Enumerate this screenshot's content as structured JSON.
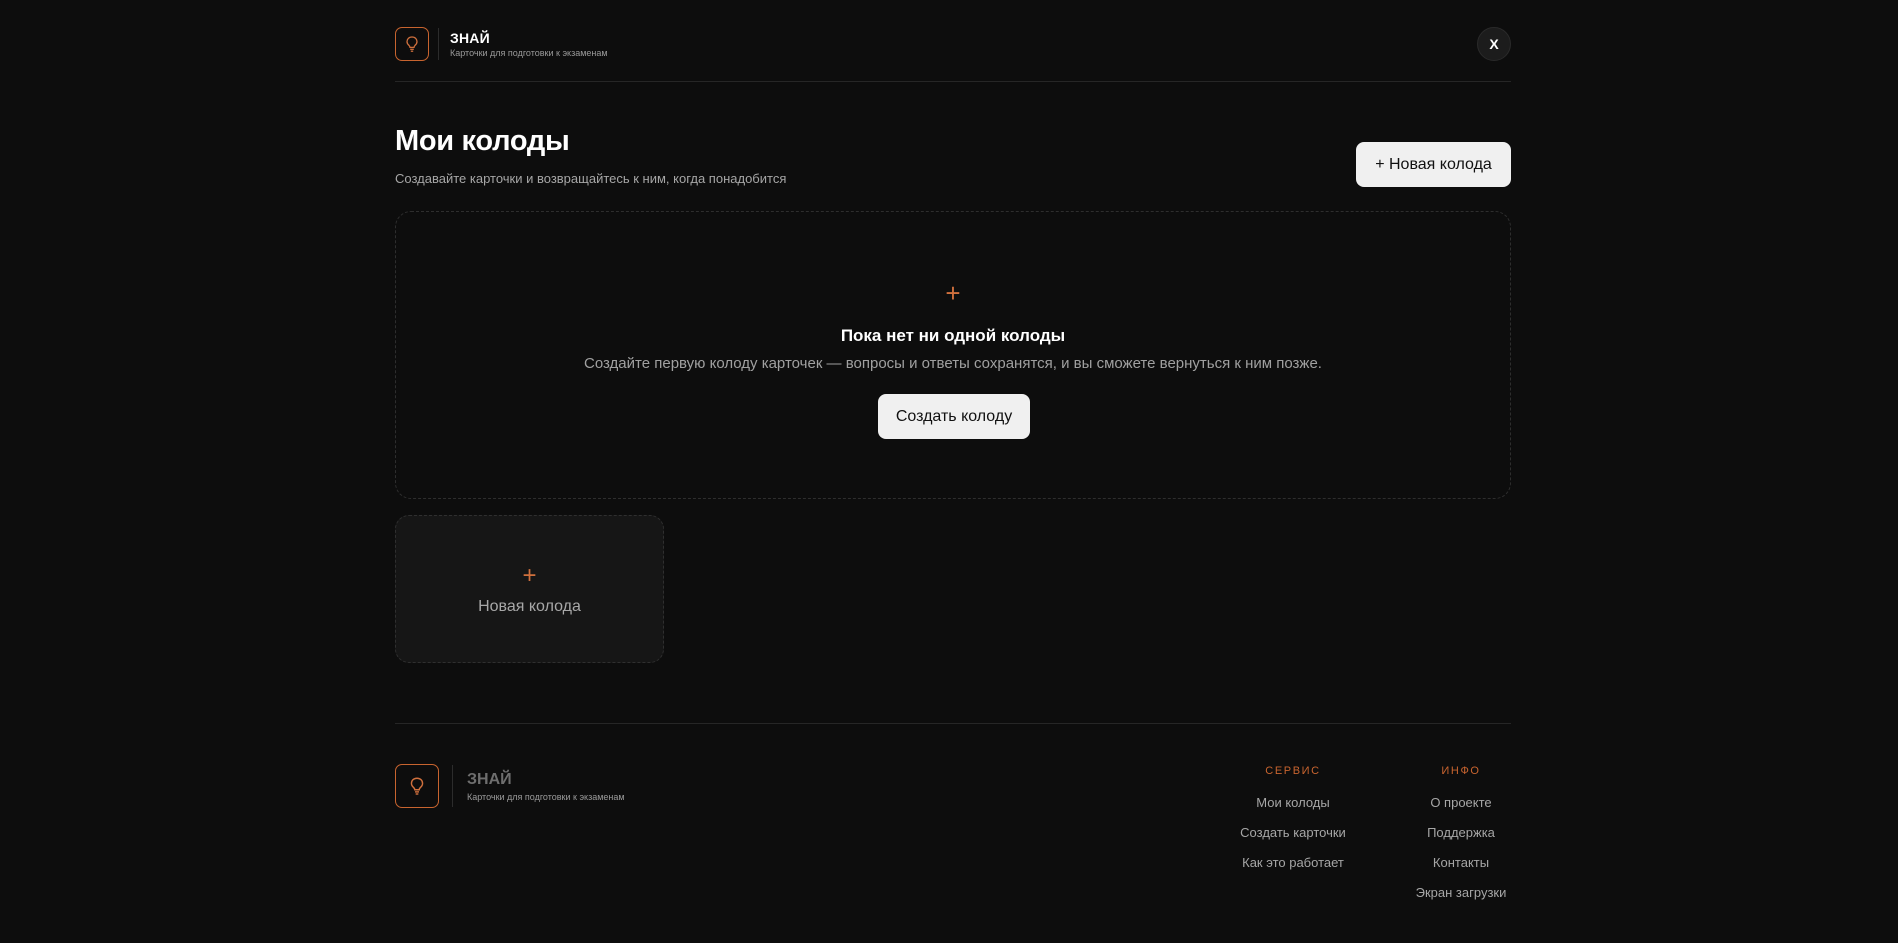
{
  "header": {
    "brand_title": "ЗНАЙ",
    "brand_subtitle": "Карточки для подготовки к экзаменам",
    "close_label": "X"
  },
  "main": {
    "title": "Мои колоды",
    "subtitle": "Создавайте карточки и возвращайтесь к ним, когда понадобится",
    "new_deck_button": "+ Новая колода"
  },
  "empty_state": {
    "plus": "+",
    "title": "Пока нет ни одной колоды",
    "text": "Создайте первую колоду карточек — вопросы и ответы сохранятся, и вы сможете вернуться к ним позже.",
    "create_button": "Создать колоду"
  },
  "deck_tile": {
    "plus": "+",
    "label": "Новая колода"
  },
  "footer": {
    "brand_title": "ЗНАЙ",
    "brand_subtitle": "Карточки для подготовки к экзаменам",
    "service": {
      "heading": "СЕРВИС",
      "links": [
        "Мои колоды",
        "Создать карточки",
        "Как это работает"
      ]
    },
    "info": {
      "heading": "ИНФО",
      "links": [
        "О проекте",
        "Поддержка",
        "Контакты",
        "Экран загрузки"
      ]
    }
  },
  "colors": {
    "background": "#0d0d0d",
    "accent": "#c8642f",
    "button_bg": "#f0f0f0"
  },
  "icons": {
    "logo": "lightbulb-icon"
  }
}
